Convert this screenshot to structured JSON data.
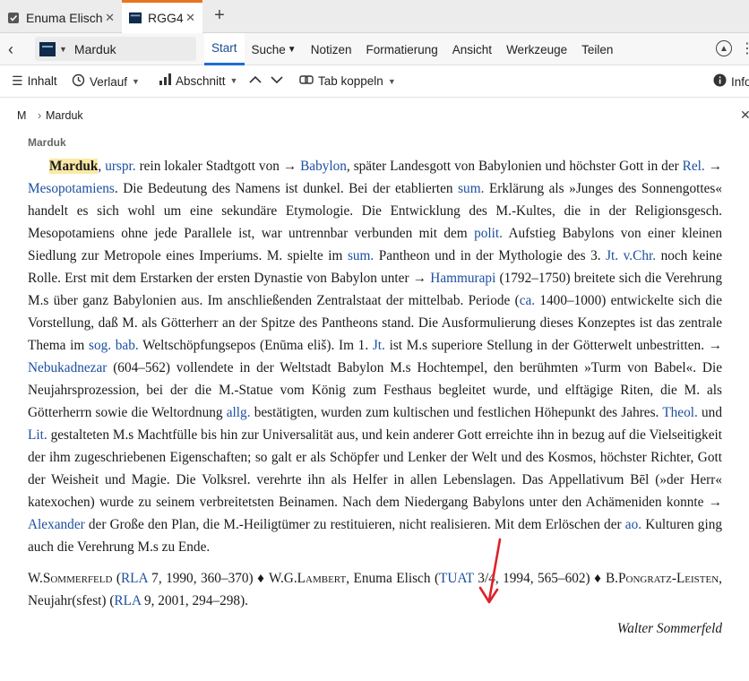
{
  "tabs": [
    {
      "label": "Enuma Elisch",
      "icon": "checkbox-icon",
      "close": "✕"
    },
    {
      "label": "RGG4",
      "icon": "rgg-icon",
      "close": "✕"
    }
  ],
  "tab_add": "+",
  "ribbon": {
    "back": "‹",
    "resource_title": "Marduk",
    "menu": [
      "Start",
      "Suche",
      "Notizen",
      "Formatierung",
      "Ansicht",
      "Werkzeuge",
      "Teilen"
    ],
    "accent": "#1a6fd1"
  },
  "toolbar": {
    "inhalt": "Inhalt",
    "verlauf": "Verlauf",
    "abschnitt": "Abschnitt",
    "tab_koppeln": "Tab koppeln",
    "info": "Info"
  },
  "breadcrumb": {
    "home": "M",
    "sep": "›",
    "current": "Marduk"
  },
  "article": {
    "label": "Marduk",
    "p": [
      {
        "t": "Marduk",
        "c": "hw"
      },
      {
        "t": ", "
      },
      {
        "t": "urspr.",
        "c": "lk"
      },
      {
        "t": " rein lokaler Stadtgott von → "
      },
      {
        "t": "Babylon",
        "c": "lk"
      },
      {
        "t": ", später Landesgott von Babylonien und höchster Gott in der "
      },
      {
        "t": "Rel.",
        "c": "lk"
      },
      {
        "t": " → "
      },
      {
        "t": "Mesopotamiens",
        "c": "lk"
      },
      {
        "t": ". Die Bedeutung des Namens ist dunkel. Bei der etablierten "
      },
      {
        "t": "sum.",
        "c": "lk"
      },
      {
        "t": " Erklärung als »Junges des Sonnengottes« handelt es sich wohl um eine sekundäre Etymologie. Die Entwicklung des M.-Kultes, die in der Religionsgesch. Mesopotamiens ohne jede Parallele ist, war untrennbar verbunden mit dem "
      },
      {
        "t": "polit.",
        "c": "lk"
      },
      {
        "t": " Aufstieg Babylons von einer kleinen Siedlung zur Metropole eines Imperiums. M. spielte im "
      },
      {
        "t": "sum.",
        "c": "lk"
      },
      {
        "t": " Pantheon und in der Mythologie des 3. "
      },
      {
        "t": "Jt.",
        "c": "lk"
      },
      {
        "t": " "
      },
      {
        "t": "v.Chr.",
        "c": "lk"
      },
      {
        "t": " noch keine Rolle. Erst mit dem Erstarken der ersten Dynastie von Babylon unter → "
      },
      {
        "t": "Hammurapi",
        "c": "lk"
      },
      {
        "t": " (1792–1750) breitete sich die Verehrung M.s über ganz Babylonien aus. Im anschließenden Zentralstaat der mittelbab. Periode ("
      },
      {
        "t": "ca.",
        "c": "lk"
      },
      {
        "t": " 1400–1000) entwickelte sich die Vorstellung, daß M. als Götterherr an der Spitze des Pantheons stand. Die Ausformulierung dieses Konzeptes ist das zentrale Thema im "
      },
      {
        "t": "sog.",
        "c": "lk"
      },
      {
        "t": " "
      },
      {
        "t": "bab.",
        "c": "lk"
      },
      {
        "t": " Weltschöpfungsepos (Enūma eliš). Im 1. "
      },
      {
        "t": "Jt.",
        "c": "lk"
      },
      {
        "t": " ist M.s superiore Stellung in der Götterwelt unbestritten. → "
      },
      {
        "t": "Nebukadnezar",
        "c": "lk"
      },
      {
        "t": " (604–562) vollendete in der Weltstadt Babylon M.s Hochtempel, den berühmten »Turm von Babel«. Die Neujahrsprozession, bei der die M.-Statue vom König zum Festhaus begleitet wurde, und elftägige Riten, die M. als Götterherrn sowie die Weltordnung "
      },
      {
        "t": "allg.",
        "c": "lk"
      },
      {
        "t": " bestätigten, wurden zum kultischen und festlichen Höhepunkt des Jahres. "
      },
      {
        "t": "Theol.",
        "c": "lk"
      },
      {
        "t": " und "
      },
      {
        "t": "Lit.",
        "c": "lk"
      },
      {
        "t": " gestalteten M.s Machtfülle bis hin zur Universalität aus, und kein anderer Gott erreichte ihn in bezug auf die Vielseitigkeit der ihm zugeschriebenen Eigenschaften; so galt er als Schöpfer und Lenker der Welt und des Kosmos, höchster Richter, Gott der Weisheit und Magie. Die Volksrel. verehrte ihn als Helfer in allen Lebenslagen. Das Appellativum Bēl (»der Herr« katexochen) wurde zu seinem verbreitetsten Beinamen. Nach dem Niedergang Babylons unter den Achämeniden konnte → "
      },
      {
        "t": "Alexander",
        "c": "lk"
      },
      {
        "t": " der Große den Plan, die M.-Heiligtümer zu restituieren, nicht realisieren. Mit dem Erlöschen der "
      },
      {
        "t": "ao.",
        "c": "lk"
      },
      {
        "t": " Kulturen ging auch die Verehrung M.s zu Ende."
      }
    ],
    "refs": [
      {
        "t": "W.Sommerfeld",
        "c": "sc"
      },
      {
        "t": " ("
      },
      {
        "t": "RLA",
        "c": "lk"
      },
      {
        "t": " 7, 1990, 360–370) ♦ "
      },
      {
        "t": "W.G.Lambert",
        "c": "sc"
      },
      {
        "t": ", Enuma Elisch ("
      },
      {
        "t": "TUAT",
        "c": "lk"
      },
      {
        "t": " 3/4, 1994, 565–602) ♦ "
      },
      {
        "t": "B.Pongratz-Leisten",
        "c": "sc"
      },
      {
        "t": ", Neujahr(sfest) ("
      },
      {
        "t": "RLA",
        "c": "lk"
      },
      {
        "t": " 9, 2001, 294–298)."
      }
    ],
    "author": "Walter Sommerfeld"
  }
}
